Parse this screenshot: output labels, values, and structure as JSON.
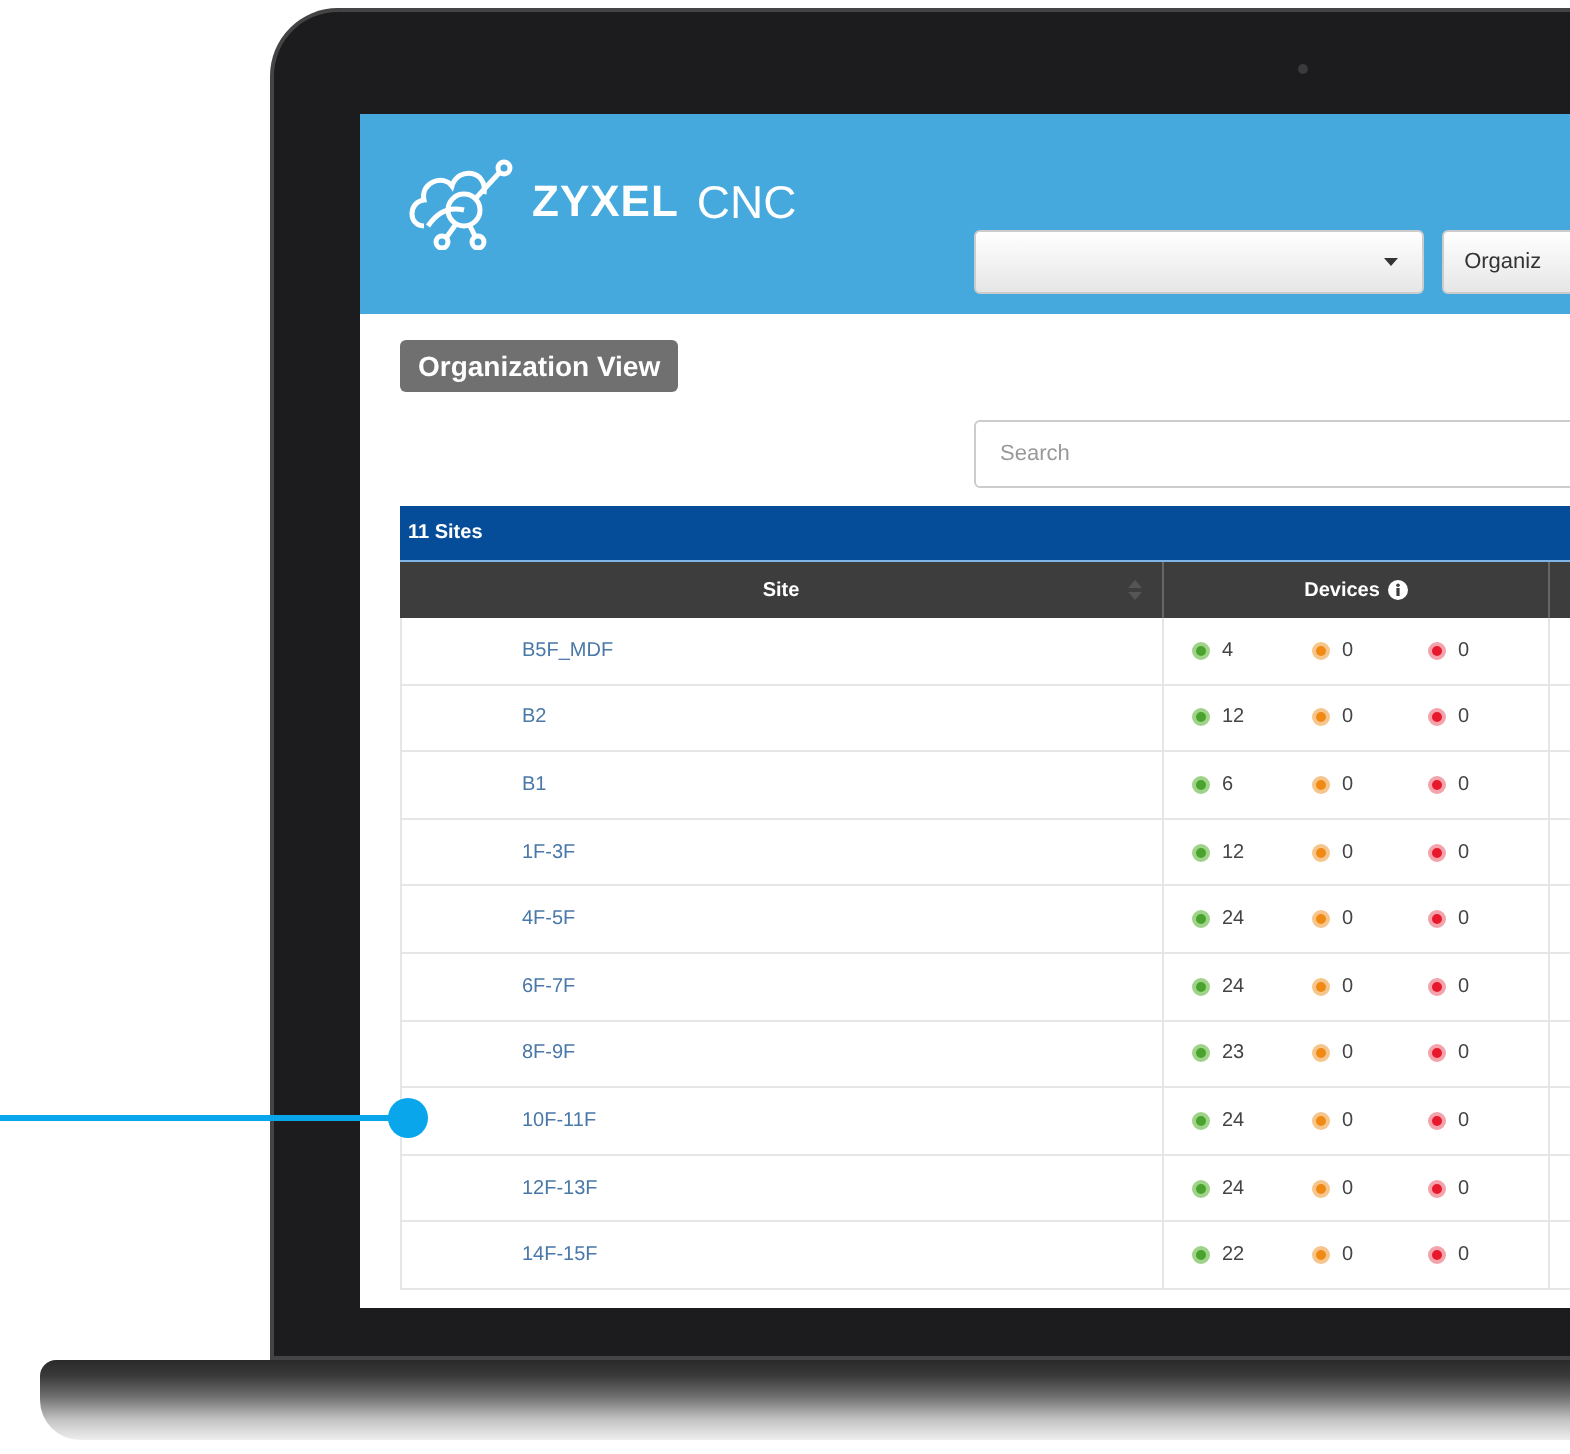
{
  "header": {
    "logo_brand": "ZYXEL",
    "logo_product": "CNC",
    "organization_button": "Organiz"
  },
  "view_label": "Organization View",
  "search": {
    "placeholder": "Search"
  },
  "table": {
    "title": "11 Sites",
    "columns": [
      {
        "label": "Site",
        "sortable": true
      },
      {
        "label": "Devices",
        "info": true
      }
    ],
    "rows": [
      {
        "site": "B5F_MDF",
        "online": "4",
        "alert": "0",
        "offline": "0"
      },
      {
        "site": "B2",
        "online": "12",
        "alert": "0",
        "offline": "0"
      },
      {
        "site": "B1",
        "online": "6",
        "alert": "0",
        "offline": "0"
      },
      {
        "site": "1F-3F",
        "online": "12",
        "alert": "0",
        "offline": "0"
      },
      {
        "site": "4F-5F",
        "online": "24",
        "alert": "0",
        "offline": "0"
      },
      {
        "site": "6F-7F",
        "online": "24",
        "alert": "0",
        "offline": "0"
      },
      {
        "site": "8F-9F",
        "online": "23",
        "alert": "0",
        "offline": "0"
      },
      {
        "site": "10F-11F",
        "online": "24",
        "alert": "0",
        "offline": "0"
      },
      {
        "site": "12F-13F",
        "online": "24",
        "alert": "0",
        "offline": "0"
      },
      {
        "site": "14F-15F",
        "online": "22",
        "alert": "0",
        "offline": "0"
      }
    ]
  }
}
